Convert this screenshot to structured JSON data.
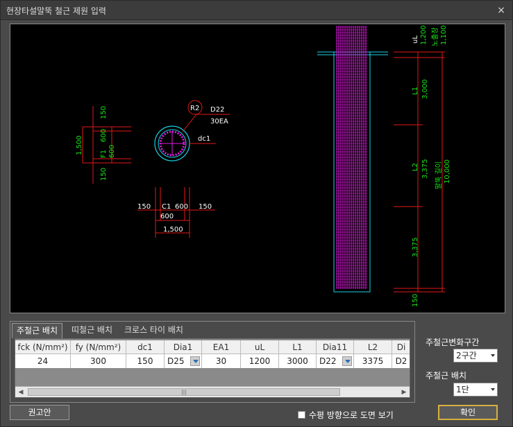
{
  "window": {
    "title": "현장타설말뚝 철근 제원 입력",
    "close_label": "×"
  },
  "drawing": {
    "section_labels": {
      "r2": "R2",
      "d22": "D22",
      "ea": "30EA",
      "dc1": "dc1",
      "dim_150_top": "150",
      "dim_600_upper": "600",
      "dim_1500_left": "1,500",
      "f1": "F1",
      "dim_600_lower": "600",
      "dim_150_bottom": "150",
      "bot_150_left": "150",
      "c1": "C1",
      "bot_600": "600",
      "bot_150_right": "150",
      "bot_600_sub": "600",
      "bot_1500": "1,500"
    },
    "elevation_labels": {
      "ul": "uL",
      "ul_val": "1,200",
      "exposed": "노출장",
      "exposed_val": "1,100",
      "l1": "L1",
      "l1_val": "3,000",
      "l2": "L2",
      "l2_val": "3,375",
      "pile_depth": "말뚝 길이",
      "pile_depth_val": "10,000",
      "l3_val": "3,375",
      "bottom_150": "150"
    }
  },
  "tabs": [
    {
      "label": "주철근 배치"
    },
    {
      "label": "띠철근 배치"
    },
    {
      "label": "크로스 타이 배치"
    }
  ],
  "grid": {
    "headers": [
      "fck (N/mm²)",
      "fy (N/mm²)",
      "dc1",
      "Dia1",
      "EA1",
      "uL",
      "L1",
      "Dia11",
      "L2",
      "Di"
    ],
    "row": [
      "24",
      "300",
      "150",
      "D25",
      "30",
      "1200",
      "3000",
      "D22",
      "3375",
      "D2"
    ]
  },
  "right_panel": {
    "zone_label": "주철근변화구간",
    "zone_value": "2구간",
    "layer_label": "주철근 배치",
    "layer_value": "1단"
  },
  "buttons": {
    "recommend": "권고안",
    "ok": "확인"
  },
  "checkbox_label": "수평 방향으로 도면 보기"
}
